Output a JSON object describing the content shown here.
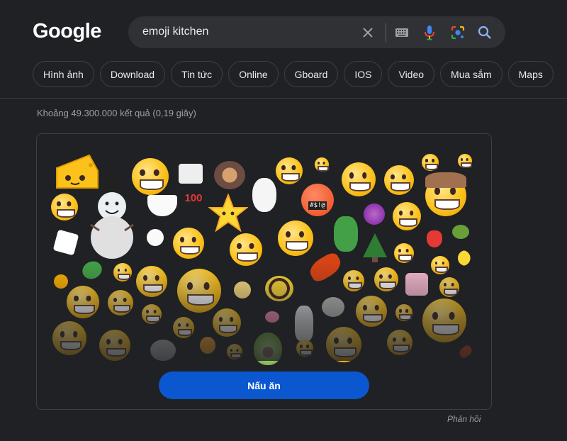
{
  "logo": "Google",
  "search": {
    "query": "emoji kitchen"
  },
  "icons": {
    "clear": "close-icon",
    "keyboard": "keyboard-icon",
    "voice": "mic-icon",
    "lens": "lens-icon",
    "search": "search-icon"
  },
  "chips": [
    "Hình ảnh",
    "Download",
    "Tin tức",
    "Online",
    "Gboard",
    "IOS",
    "Video",
    "Mua sắm",
    "Maps"
  ],
  "result_stats": "Khoảng 49.300.000 kết quả (0,19 giây)",
  "emoji_kitchen": {
    "button_label": "Nấu ăn"
  },
  "feedback": "Phản hồi",
  "colors": {
    "background": "#202124",
    "search_box": "#303134",
    "button": "#0b57d0",
    "chip_border": "#3c4043"
  }
}
